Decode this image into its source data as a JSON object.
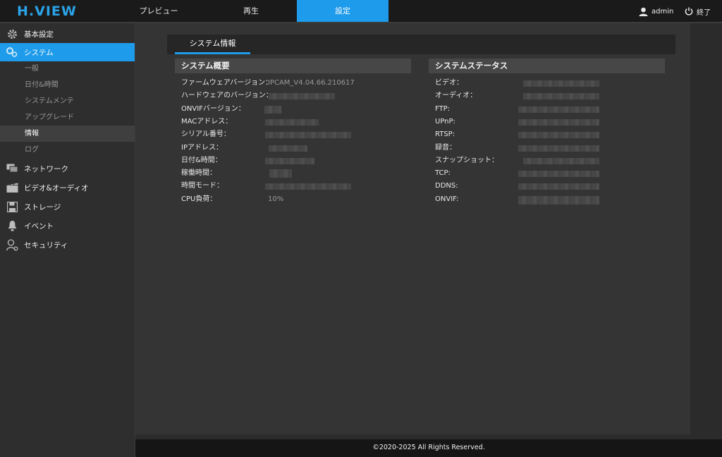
{
  "header": {
    "logo_text": "H.VIEW",
    "tabs": [
      {
        "label": "プレビュー"
      },
      {
        "label": "再生"
      },
      {
        "label": "設定"
      }
    ],
    "user": "admin",
    "logout": "終了"
  },
  "sidebar": {
    "items": [
      {
        "label": "基本設定",
        "icon": "gear-icon"
      },
      {
        "label": "システム",
        "icon": "system-icon"
      },
      {
        "label": "ネットワーク",
        "icon": "network-icon"
      },
      {
        "label": "ビデオ&オーディオ",
        "icon": "video-audio-icon"
      },
      {
        "label": "ストレージ",
        "icon": "storage-icon"
      },
      {
        "label": "イベント",
        "icon": "event-icon"
      },
      {
        "label": "セキュリティ",
        "icon": "security-icon"
      }
    ],
    "subitems": [
      {
        "label": "一般"
      },
      {
        "label": "日付&時間"
      },
      {
        "label": "システムメンテ"
      },
      {
        "label": "アップグレード"
      },
      {
        "label": "情報"
      },
      {
        "label": "ログ"
      }
    ]
  },
  "main": {
    "tab": "システム情報",
    "overview": {
      "title": "システム概要",
      "rows": [
        {
          "label": "ファームウェアバージョン：",
          "value": "IPCAM_V4.04.66.210617"
        },
        {
          "label": "ハードウェアのバージョン：",
          "value": ""
        },
        {
          "label": "ONVIFバージョン：",
          "value": ""
        },
        {
          "label": "MACアドレス：",
          "value": ""
        },
        {
          "label": "シリアル番号：",
          "value": ""
        },
        {
          "label": "IPアドレス：",
          "value": ""
        },
        {
          "label": "日付&時間：",
          "value": ""
        },
        {
          "label": "稼働時間：",
          "value": ""
        },
        {
          "label": "時間モード：",
          "value": ""
        },
        {
          "label": "CPU負荷：",
          "value": "10%"
        }
      ]
    },
    "status": {
      "title": "システムステータス",
      "rows": [
        {
          "label": "ビデオ："
        },
        {
          "label": "オーディオ："
        },
        {
          "label": "FTP:"
        },
        {
          "label": "UPnP:"
        },
        {
          "label": "RTSP:"
        },
        {
          "label": "録音："
        },
        {
          "label": "スナップショット："
        },
        {
          "label": "TCP:"
        },
        {
          "label": "DDNS:"
        },
        {
          "label": "ONVIF:"
        }
      ]
    }
  },
  "footer": {
    "text": "©2020-2025 All Rights Reserved."
  },
  "colors": {
    "accent": "#1e9bea",
    "background": "#2b2b2b",
    "panel": "#343434"
  }
}
